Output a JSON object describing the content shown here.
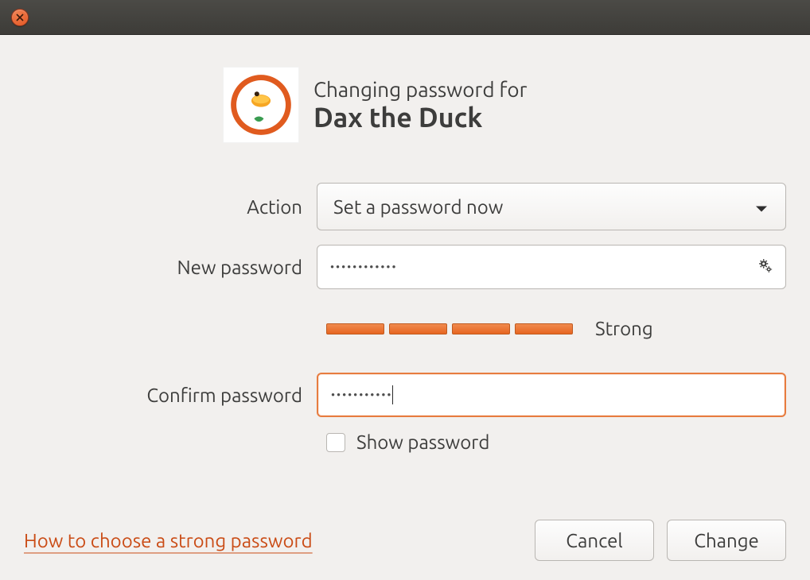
{
  "header": {
    "line1": "Changing password for",
    "username": "Dax the Duck"
  },
  "labels": {
    "action": "Action",
    "new_password": "New password",
    "confirm_password": "Confirm password"
  },
  "action_select": {
    "selected": "Set a password now"
  },
  "new_password": {
    "masked_value": "••••••••••••"
  },
  "confirm_password": {
    "masked_value": "•••••••••••"
  },
  "strength": {
    "label": "Strong",
    "segments": 4
  },
  "show_password": {
    "label": "Show password",
    "checked": false
  },
  "footer": {
    "help_link": "How to choose a strong password",
    "cancel": "Cancel",
    "change": "Change"
  }
}
